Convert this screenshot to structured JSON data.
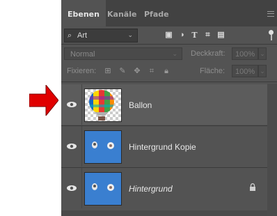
{
  "tabs": [
    "Ebenen",
    "Kanäle",
    "Pfade"
  ],
  "filter": {
    "label": "Art"
  },
  "blend": {
    "mode": "Normal",
    "opacity_label": "Deckkraft:",
    "opacity_value": "100%"
  },
  "lock": {
    "label": "Fixieren:",
    "fill_label": "Fläche:",
    "fill_value": "100%"
  },
  "layers": [
    {
      "name": "Ballon",
      "italic": false,
      "locked": false,
      "selected": true
    },
    {
      "name": "Hintergrund Kopie",
      "italic": false,
      "locked": false,
      "selected": false
    },
    {
      "name": "Hintergrund",
      "italic": true,
      "locked": true,
      "selected": false
    }
  ],
  "colors": {
    "panel": "#535353",
    "arrow": "#e00000",
    "thumb_blue": "#3a7fd0"
  }
}
